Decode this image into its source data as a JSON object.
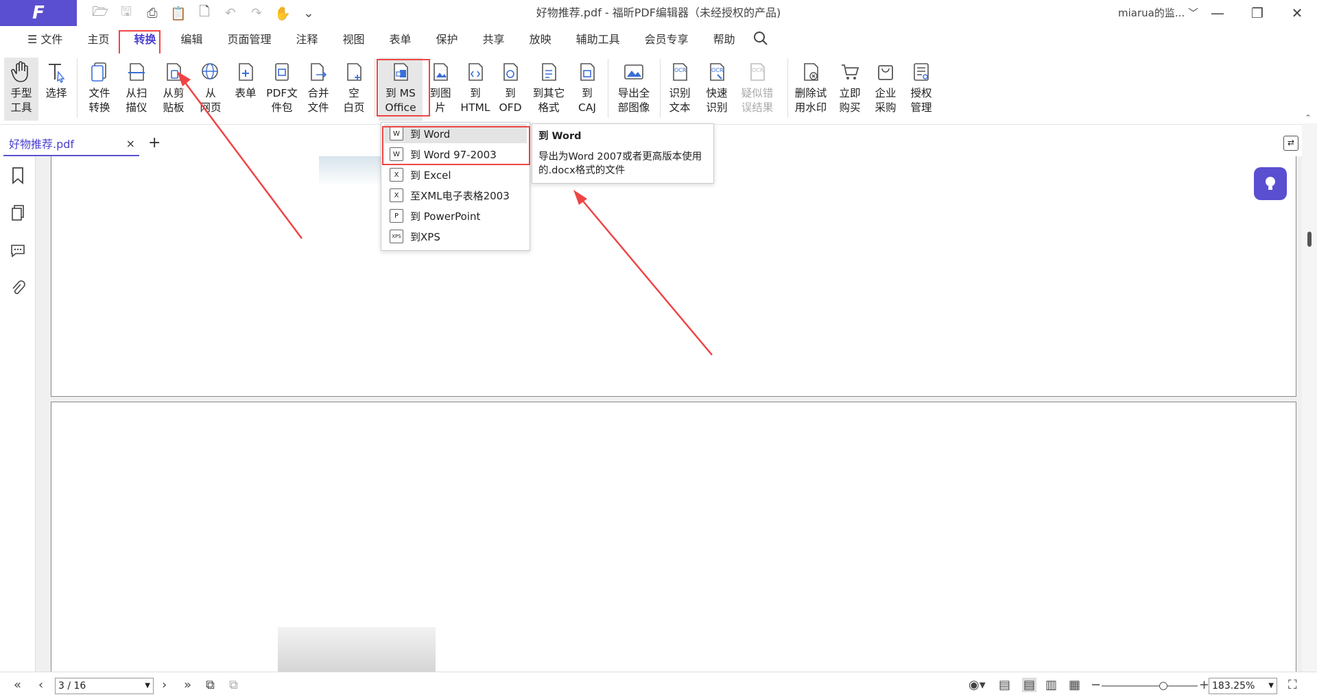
{
  "titlebar": {
    "logo": "F",
    "title": "好物推荐.pdf - 福昕PDF编辑器（未经授权的产品)",
    "user": "miarua的监...",
    "user_chevron": "﹀"
  },
  "menu": [
    "☰ 文件",
    "主页",
    "转换",
    "编辑",
    "页面管理",
    "注释",
    "视图",
    "表单",
    "保护",
    "共享",
    "放映",
    "辅助工具",
    "会员专享",
    "帮助"
  ],
  "ribbon": {
    "hand": "手型\n工具",
    "select": "选择",
    "file_convert": "文件\n转换",
    "from_scanner": "从扫\n描仪",
    "from_clipboard": "从剪\n贴板",
    "from_web": "从\n网页",
    "form": "表单",
    "pdf_package": "PDF文\n件包",
    "merge": "合并\n文件",
    "blank": "空\n白页",
    "to_ms_office": "到 MS\nOffice",
    "to_image": "到图\n片",
    "to_html": "到\nHTML",
    "to_ofd": "到\nOFD",
    "to_other": "到其它\n格式",
    "to_caj": "到\nCAJ",
    "export_images": "导出全\n部图像",
    "ocr_text": "识别\n文本",
    "ocr_quick": "快速\n识别",
    "ocr_suspect": "疑似错\n误结果",
    "remove_watermark": "删除试\n用水印",
    "buy_now": "立即\n购买",
    "enterprise": "企业\n采购",
    "license": "授权\n管理"
  },
  "tab": {
    "name": "好物推荐.pdf",
    "close": "×",
    "add": "+"
  },
  "dropdown": [
    {
      "label": "到 Word",
      "icon": "W"
    },
    {
      "label": "到 Word 97-2003",
      "icon": "W"
    },
    {
      "label": "到 Excel",
      "icon": "X"
    },
    {
      "label": "至XML电子表格2003",
      "icon": "X"
    },
    {
      "label": "到 PowerPoint",
      "icon": "P"
    },
    {
      "label": "到XPS",
      "icon": "XPS"
    }
  ],
  "tooltip": {
    "title": "到 Word",
    "body": "导出为Word 2007或者更高版本使用的.docx格式的文件"
  },
  "status": {
    "page": "3 / 16",
    "zoom": "183.25%"
  },
  "colors": {
    "brand": "#5a4fd0",
    "highlight": "#ef4444"
  }
}
